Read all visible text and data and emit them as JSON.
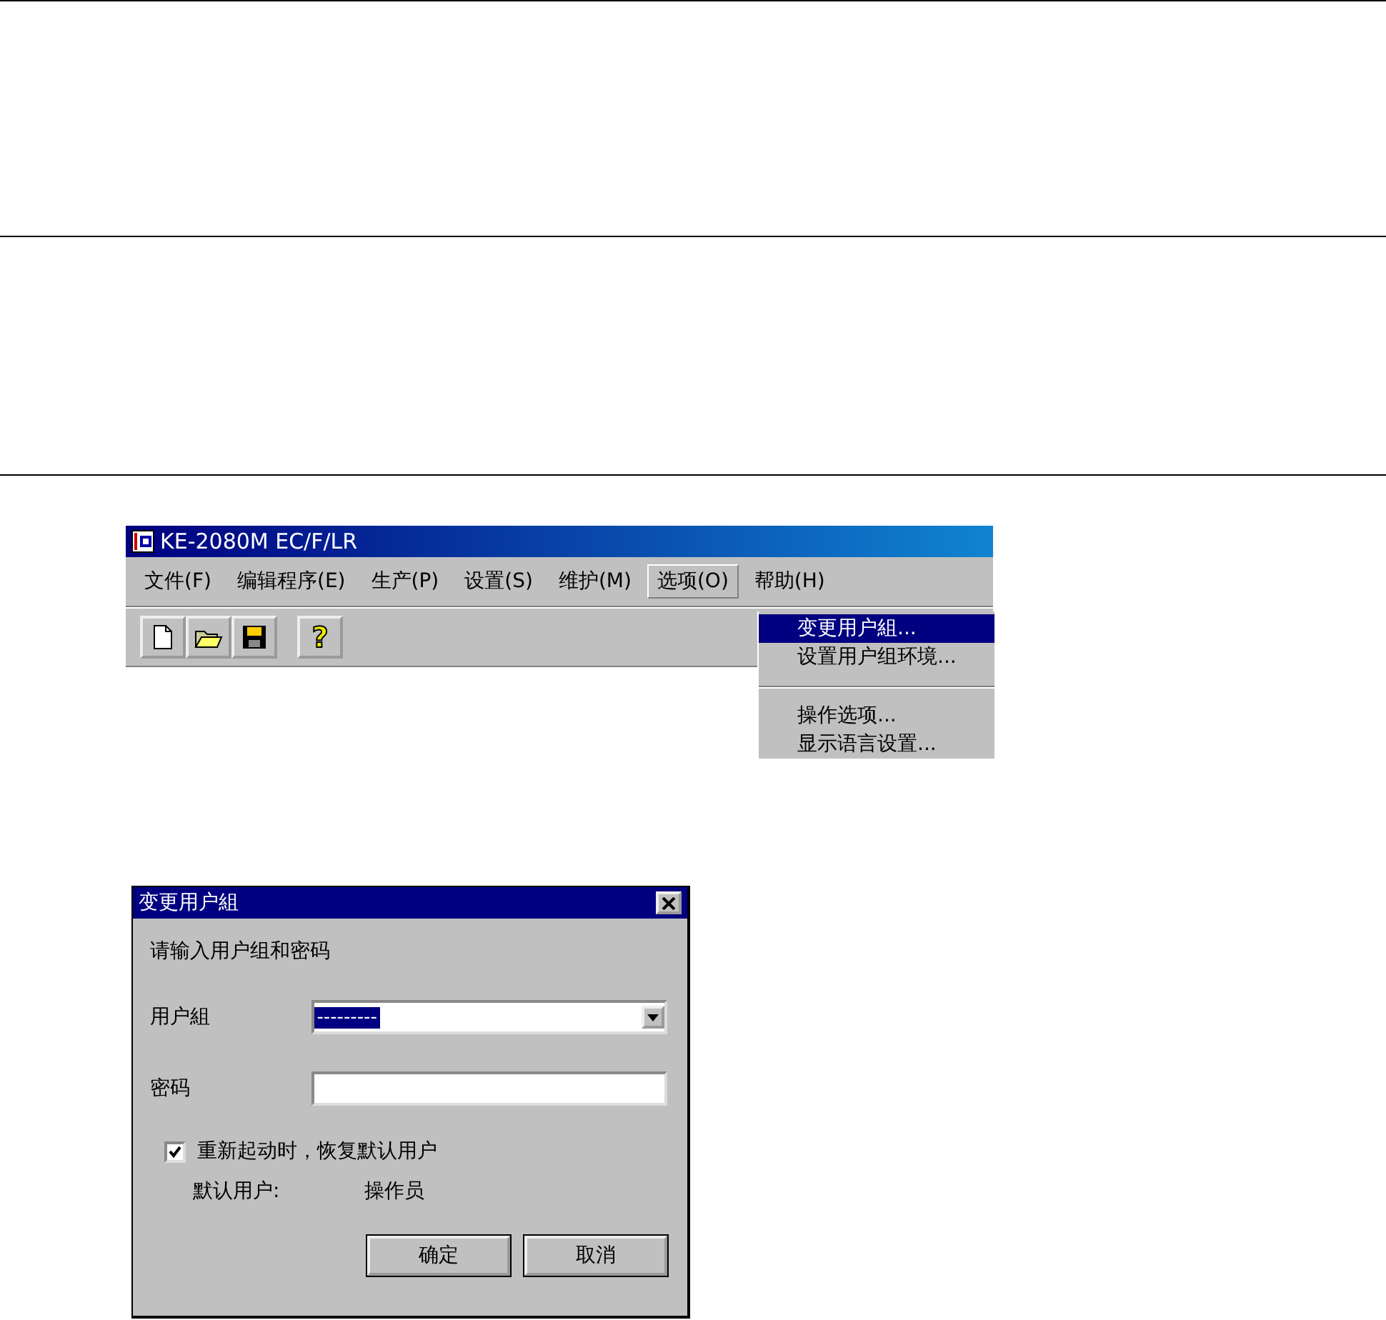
{
  "app_window": {
    "title": "KE-2080M EC/F/LR",
    "menu": [
      {
        "label": "文件(F)",
        "selected": false
      },
      {
        "label": "编辑程序(E)",
        "selected": false
      },
      {
        "label": "生产(P)",
        "selected": false
      },
      {
        "label": "设置(S)",
        "selected": false
      },
      {
        "label": "维护(M)",
        "selected": false
      },
      {
        "label": "选项(O)",
        "selected": true
      },
      {
        "label": "帮助(H)",
        "selected": false
      }
    ],
    "toolbar": [
      {
        "kind": "new"
      },
      {
        "kind": "open"
      },
      {
        "kind": "save"
      },
      {
        "kind": "help",
        "label": "?"
      }
    ],
    "dropdown": [
      {
        "kind": "item",
        "label": "变更用户組...",
        "selected": true
      },
      {
        "kind": "item",
        "label": "设置用户组环境...",
        "selected": false
      },
      {
        "kind": "separator"
      },
      {
        "kind": "item",
        "label": "操作选项...",
        "selected": false
      },
      {
        "kind": "item",
        "label": "显示语言设置...",
        "selected": false
      }
    ]
  },
  "dialog": {
    "title": "变更用户組",
    "prompt": "请输入用户组和密码",
    "user_group": {
      "label": "用户組",
      "value": "---------",
      "value_selected": true
    },
    "password": {
      "label": "密码"
    },
    "restore_default": {
      "label": "重新起动时，恢复默认用户",
      "checked": true
    },
    "default_user": {
      "label": "默认用户:",
      "value": "操作员"
    },
    "buttons": [
      "确定",
      "取消"
    ]
  }
}
